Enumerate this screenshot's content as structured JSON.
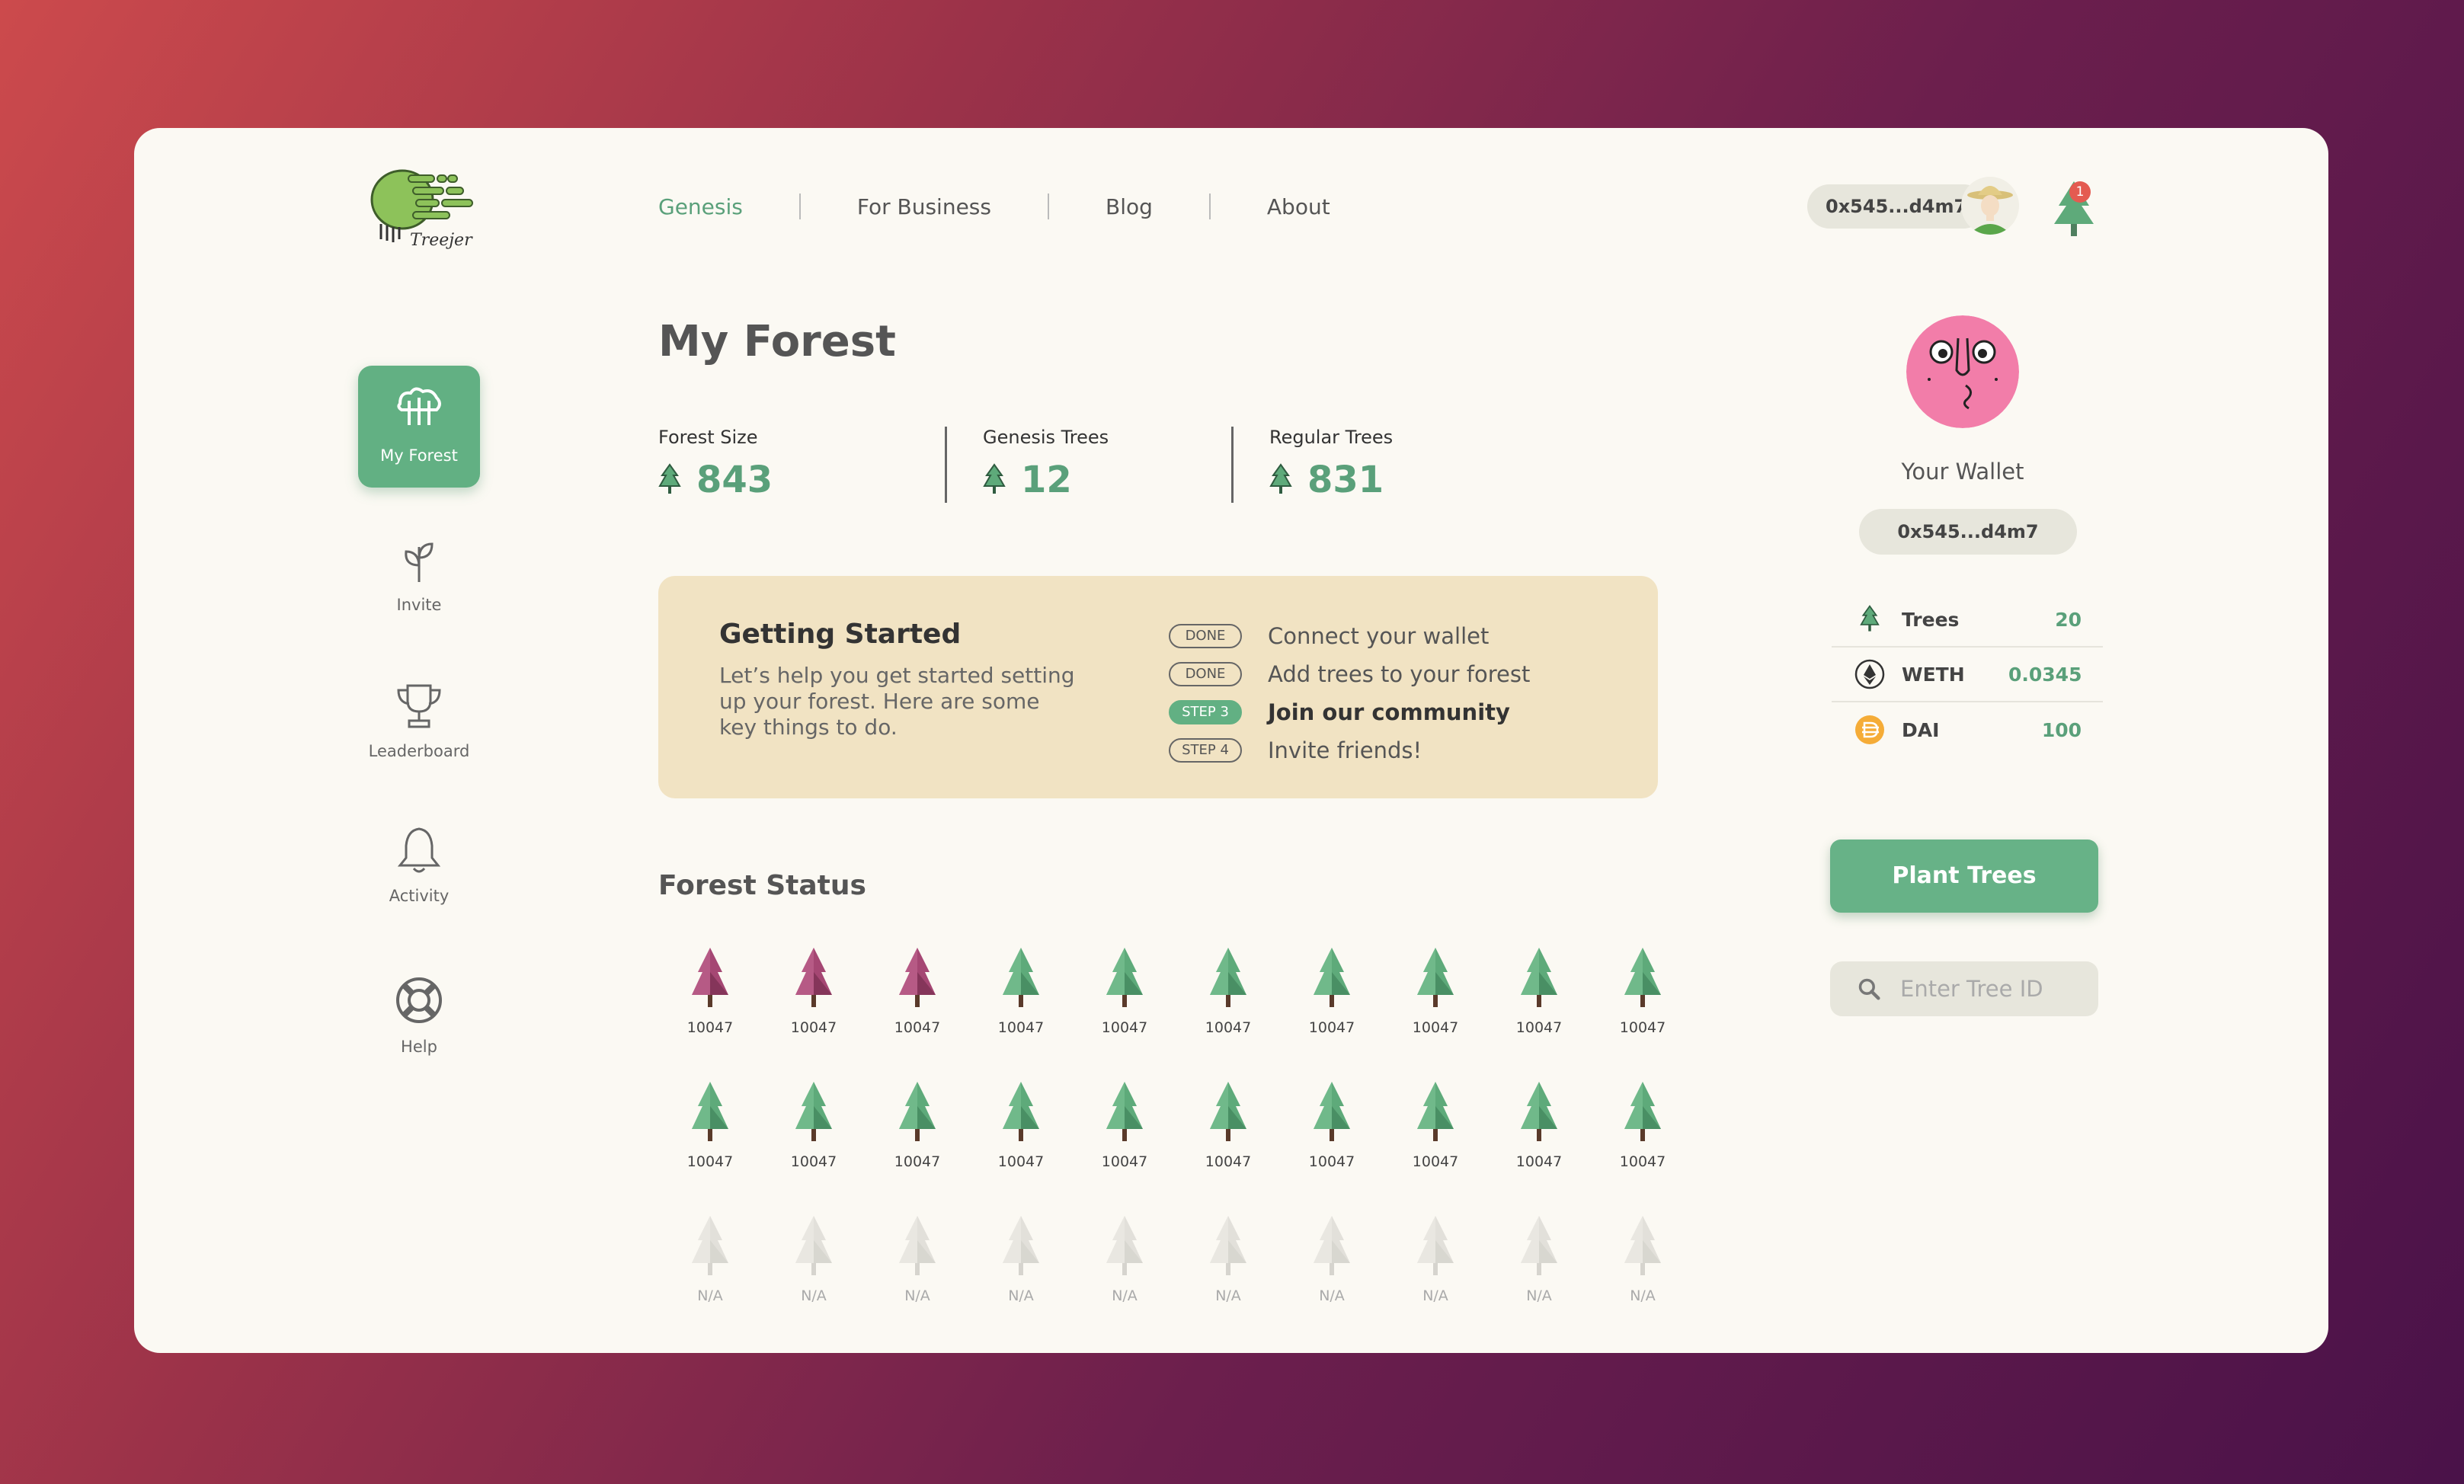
{
  "nav": [
    {
      "label": "Genesis",
      "active": true
    },
    {
      "label": "For Business"
    },
    {
      "label": "Blog"
    },
    {
      "label": "About"
    }
  ],
  "header": {
    "wallet_short": "0x545...d4m7",
    "notification_count": "1"
  },
  "sidebar": [
    {
      "label": "My Forest",
      "icon": "forest-icon",
      "active": true
    },
    {
      "label": "Invite",
      "icon": "sprout-icon"
    },
    {
      "label": "Leaderboard",
      "icon": "trophy-icon"
    },
    {
      "label": "Activity",
      "icon": "bell-icon"
    },
    {
      "label": "Help",
      "icon": "lifebuoy-icon"
    }
  ],
  "main": {
    "title": "My Forest",
    "stats": [
      {
        "label": "Forest Size",
        "value": "843"
      },
      {
        "label": "Genesis Trees",
        "value": "12"
      },
      {
        "label": "Regular Trees",
        "value": "831"
      }
    ],
    "getting_started": {
      "title": "Getting Started",
      "description": "Let’s help you get started setting up your forest. Here are some key things to do.",
      "steps": [
        {
          "badge": "DONE",
          "text": "Connect your wallet"
        },
        {
          "badge": "DONE",
          "text": "Add trees to your forest"
        },
        {
          "badge": "STEP 3",
          "text": "Join our community",
          "current": true
        },
        {
          "badge": "STEP 4",
          "text": "Invite friends!"
        }
      ]
    },
    "forest_status_title": "Forest Status",
    "trees": [
      {
        "label": "10047",
        "kind": "genesis"
      },
      {
        "label": "10047",
        "kind": "genesis"
      },
      {
        "label": "10047",
        "kind": "genesis"
      },
      {
        "label": "10047",
        "kind": "regular"
      },
      {
        "label": "10047",
        "kind": "regular"
      },
      {
        "label": "10047",
        "kind": "regular"
      },
      {
        "label": "10047",
        "kind": "regular"
      },
      {
        "label": "10047",
        "kind": "regular"
      },
      {
        "label": "10047",
        "kind": "regular"
      },
      {
        "label": "10047",
        "kind": "regular"
      },
      {
        "label": "10047",
        "kind": "regular"
      },
      {
        "label": "10047",
        "kind": "regular"
      },
      {
        "label": "10047",
        "kind": "regular"
      },
      {
        "label": "10047",
        "kind": "regular"
      },
      {
        "label": "10047",
        "kind": "regular"
      },
      {
        "label": "10047",
        "kind": "regular"
      },
      {
        "label": "10047",
        "kind": "regular"
      },
      {
        "label": "10047",
        "kind": "regular"
      },
      {
        "label": "10047",
        "kind": "regular"
      },
      {
        "label": "10047",
        "kind": "regular"
      },
      {
        "label": "N/A",
        "kind": "empty"
      },
      {
        "label": "N/A",
        "kind": "empty"
      },
      {
        "label": "N/A",
        "kind": "empty"
      },
      {
        "label": "N/A",
        "kind": "empty"
      },
      {
        "label": "N/A",
        "kind": "empty"
      },
      {
        "label": "N/A",
        "kind": "empty"
      },
      {
        "label": "N/A",
        "kind": "empty"
      },
      {
        "label": "N/A",
        "kind": "empty"
      },
      {
        "label": "N/A",
        "kind": "empty"
      },
      {
        "label": "N/A",
        "kind": "empty"
      }
    ]
  },
  "wallet": {
    "title": "Your Wallet",
    "address": "0x545...d4m7",
    "assets": [
      {
        "name": "Trees",
        "value": "20",
        "icon": "tree-icon"
      },
      {
        "name": "WETH",
        "value": "0.0345",
        "icon": "eth-icon"
      },
      {
        "name": "DAI",
        "value": "100",
        "icon": "dai-icon"
      }
    ],
    "plant_button": "Plant Trees",
    "search_placeholder": "Enter Tree ID"
  },
  "colors": {
    "accent": "#62b083",
    "genesis_tree": "#a54773",
    "regular_tree": "#5eaa7a",
    "empty_tree": "#e2e0da"
  }
}
